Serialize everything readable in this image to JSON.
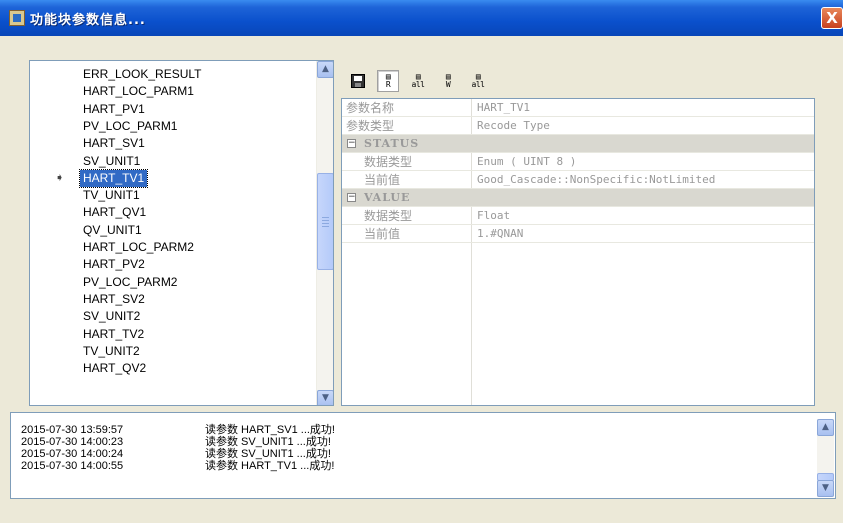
{
  "window": {
    "title": "功能块参数信息...",
    "close_label": "X"
  },
  "tree": {
    "selected_index": 6,
    "items": [
      "ERR_LOOK_RESULT",
      "HART_LOC_PARM1",
      "HART_PV1",
      "PV_LOC_PARM1",
      "HART_SV1",
      "SV_UNIT1",
      "HART_TV1",
      "TV_UNIT1",
      "HART_QV1",
      "QV_UNIT1",
      "HART_LOC_PARM2",
      "HART_PV2",
      "PV_LOC_PARM2",
      "HART_SV2",
      "SV_UNIT2",
      "HART_TV2",
      "TV_UNIT2",
      "HART_QV2"
    ],
    "marker_glyph": "➧",
    "scroll_up": "▲",
    "scroll_down": "▼"
  },
  "toolbar": {
    "save_icon": "save-icon",
    "btn1_glyph": "R",
    "btn2_glyph": "all",
    "btn3_glyph": "W",
    "btn4_glyph": "all"
  },
  "properties": {
    "rows": [
      {
        "kind": "field",
        "name": "参数名称",
        "value": "HART_TV1"
      },
      {
        "kind": "field",
        "name": "参数类型",
        "value": "Recode Type"
      },
      {
        "kind": "group",
        "name": "STATUS",
        "toggle": "−"
      },
      {
        "kind": "sub",
        "name": "数据类型",
        "value": "Enum ( UINT 8 )"
      },
      {
        "kind": "sub",
        "name": "当前值",
        "value": "Good_Cascade::NonSpecific:NotLimited"
      },
      {
        "kind": "group",
        "name": "VALUE",
        "toggle": "−"
      },
      {
        "kind": "sub",
        "name": "数据类型",
        "value": "Float"
      },
      {
        "kind": "sub",
        "name": "当前值",
        "value": "1.#QNAN"
      }
    ]
  },
  "log": {
    "entries": [
      {
        "time": "2015-07-30 13:59:57",
        "message": "读参数 HART_SV1 ...成功!"
      },
      {
        "time": "2015-07-30 14:00:23",
        "message": "读参数 SV_UNIT1 ...成功!"
      },
      {
        "time": "2015-07-30 14:00:24",
        "message": "读参数 SV_UNIT1 ...成功!"
      },
      {
        "time": "2015-07-30 14:00:55",
        "message": "读参数 HART_TV1 ...成功!"
      }
    ],
    "scroll_up": "▲",
    "scroll_down": "▼"
  }
}
